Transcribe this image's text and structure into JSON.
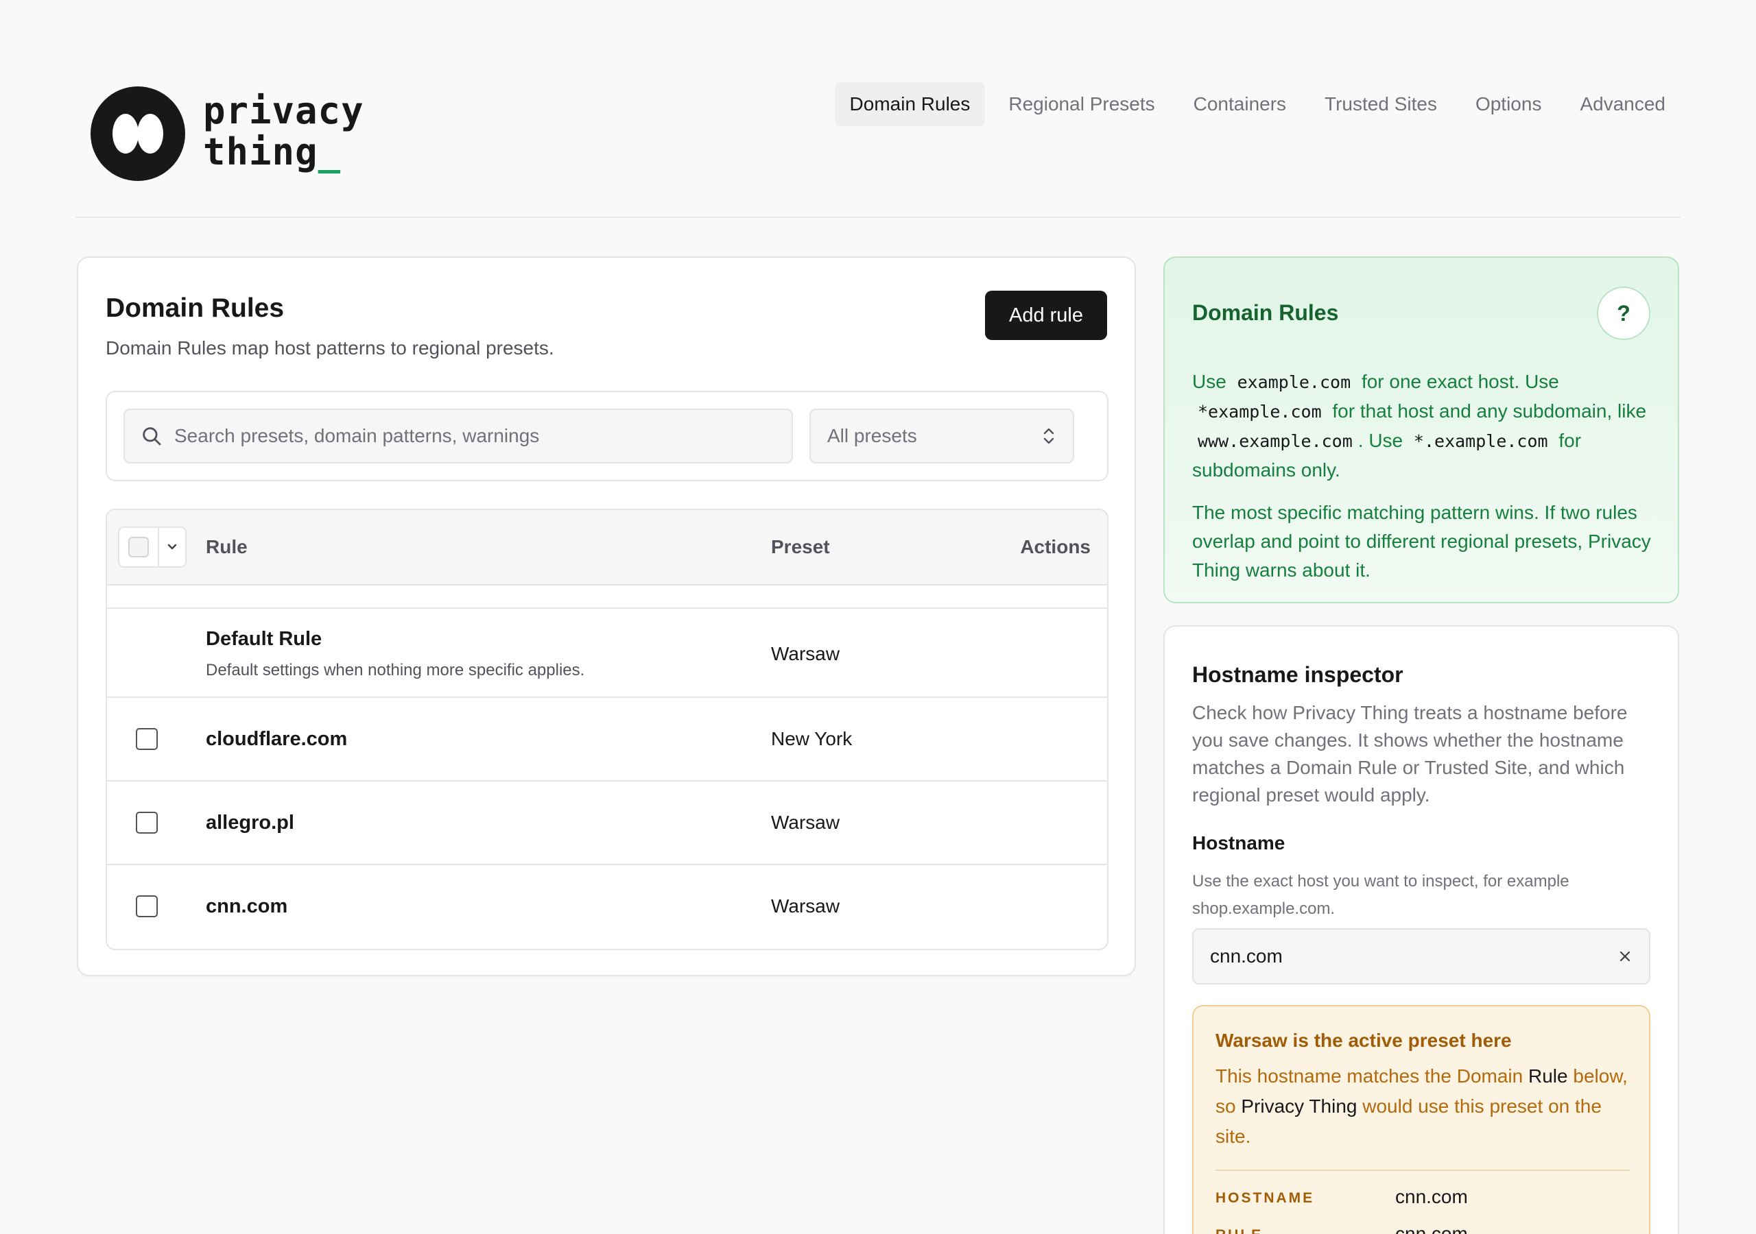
{
  "app": {
    "logo_line1": "privacy",
    "logo_line2": "thing",
    "logo_cursor": "_"
  },
  "nav": {
    "items": [
      {
        "label": "Domain Rules",
        "active": true
      },
      {
        "label": "Regional Presets",
        "active": false
      },
      {
        "label": "Containers",
        "active": false
      },
      {
        "label": "Trusted Sites",
        "active": false
      },
      {
        "label": "Options",
        "active": false
      },
      {
        "label": "Advanced",
        "active": false
      }
    ]
  },
  "rules_card": {
    "title": "Domain Rules",
    "subtitle": "Domain Rules map host patterns to regional presets.",
    "add_label": "Add rule",
    "search_placeholder": "Search presets, domain patterns, warnings",
    "preset_filter": "All presets",
    "columns": {
      "rule": "Rule",
      "preset": "Preset",
      "actions": "Actions"
    },
    "default_rule": {
      "name": "Default Rule",
      "description": "Default settings when nothing more specific applies.",
      "preset": "Warsaw"
    },
    "rows": [
      {
        "name": "cloudflare.com",
        "preset": "New York",
        "checked": false
      },
      {
        "name": "allegro.pl",
        "preset": "Warsaw",
        "checked": false
      },
      {
        "name": "cnn.com",
        "preset": "Warsaw",
        "checked": false
      }
    ]
  },
  "info_card": {
    "title": "Domain Rules",
    "help_label": "?",
    "p1": {
      "t1": "Use",
      "c1": "example.com",
      "t2": "for one exact host. Use",
      "c2": "*example.com",
      "t3": "for that host and any subdomain, like",
      "c3": "www.example.com",
      "t4": ". Use",
      "c4": "*.example.com",
      "t5": "for subdomains only."
    },
    "p2": "The most specific matching pattern wins. If two rules overlap and point to different regional presets, Privacy Thing warns about it."
  },
  "inspector": {
    "title": "Hostname inspector",
    "description": "Check how Privacy Thing treats a hostname before you save changes. It shows whether the hostname matches a Domain Rule or Trusted Site, and which regional preset would apply.",
    "field_label": "Hostname",
    "field_help": "Use the exact host you want to inspect, for example shop.example.com.",
    "field_value": "cnn.com",
    "result": {
      "title": "Warsaw is the active preset here",
      "b1": "This hostname matches the Domain",
      "b2": "Rule",
      "b3": "below, so",
      "b4": "Privacy Thing",
      "b5": "would use this preset on the site.",
      "details": [
        {
          "key": "HOSTNAME",
          "value": "cnn.com"
        },
        {
          "key": "RULE",
          "value": "cnn.com"
        }
      ]
    }
  },
  "colors": {
    "accent": "#18181b",
    "success_text": "#15803d",
    "warning_text": "#a15c07",
    "logo_cursor": "#15a35c"
  }
}
